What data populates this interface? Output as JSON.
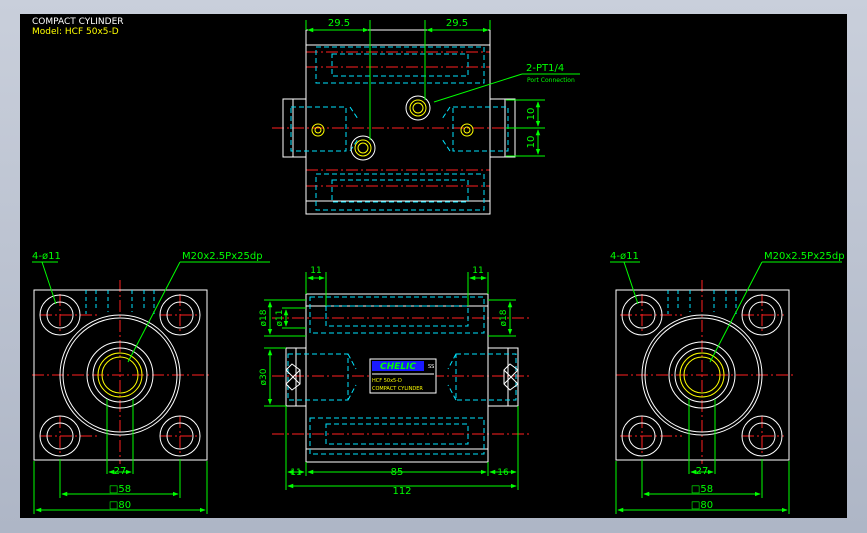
{
  "header": {
    "title": "COMPACT CYLINDER",
    "model": "Model: HCF 50x5-D"
  },
  "top_view": {
    "dim_left": "29.5",
    "dim_right": "29.5",
    "port_label": "2-PT1/4",
    "port_sublabel": "Port Connection",
    "dim_side_a": "10",
    "dim_side_b": "10"
  },
  "left_view": {
    "holes_label": "4-ø11",
    "thread_label": "M20x2.5Px25dp",
    "dim_inner": "27",
    "dim_square": "□58",
    "dim_outer": "□80"
  },
  "front_view": {
    "dim_top_left": "11",
    "dim_top_right": "11",
    "dim_bore_left": "ø18",
    "dim_rod_left": "ø11",
    "dim_bore_right": "ø18",
    "dim_body": "ø30",
    "dim_bottom_left": "11",
    "dim_bottom_mid": "85",
    "dim_bottom_right": "16",
    "dim_total": "112",
    "nameplate": {
      "brand": "CHELIC",
      "mark": "SS",
      "model": "HCF 50x5-D",
      "type": "COMPACT CYLINDER"
    }
  },
  "right_view": {
    "holes_label": "4-ø11",
    "thread_label": "M20x2.5Px25dp",
    "dim_inner": "27",
    "dim_square": "□58",
    "dim_outer": "□80"
  },
  "colors": {
    "background": "#000000",
    "outline": "#ffffff",
    "hidden": "#00e5ff",
    "center": "#ff2020",
    "dimension": "#00ff00",
    "highlight": "#ffff00"
  }
}
